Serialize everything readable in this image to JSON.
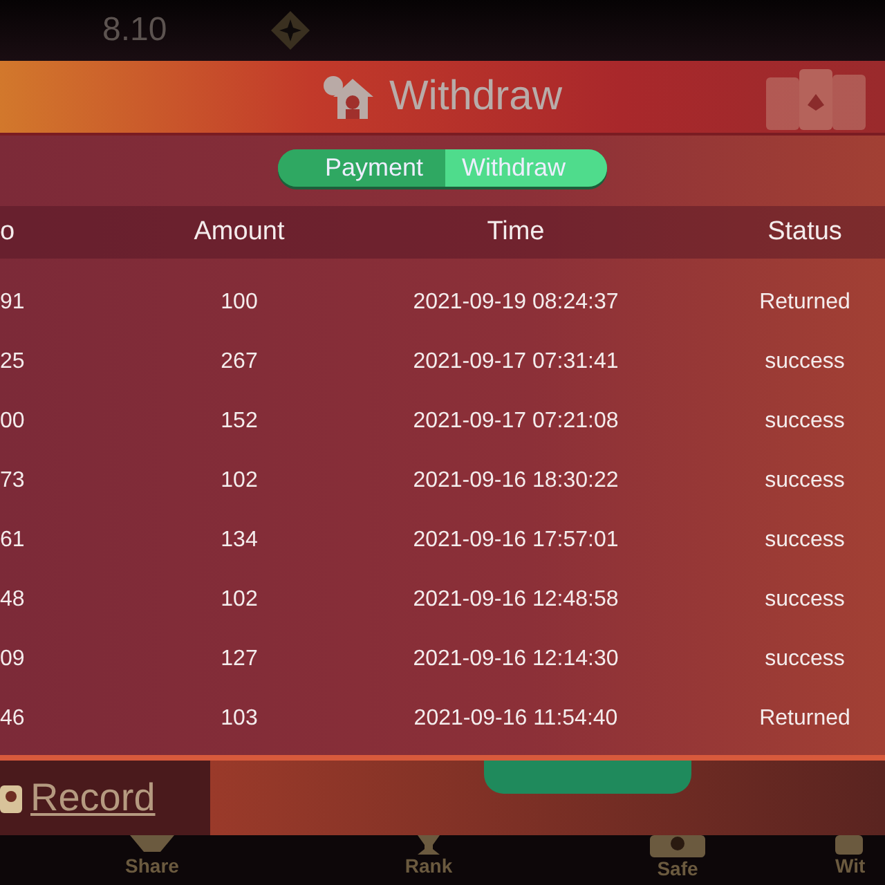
{
  "top_bar": {
    "balance": "8.10"
  },
  "dialog": {
    "title": "Withdraw",
    "tabs": [
      {
        "label": "Payment",
        "selected": false
      },
      {
        "label": "Withdraw",
        "selected": true
      }
    ],
    "table": {
      "columns": [
        "o",
        "Amount",
        "Time",
        "Status"
      ],
      "rows": [
        [
          "91",
          "100",
          "2021-09-19 08:24:37",
          "Returned"
        ],
        [
          "25",
          "267",
          "2021-09-17 07:31:41",
          "success"
        ],
        [
          "00",
          "152",
          "2021-09-17 07:21:08",
          "success"
        ],
        [
          "73",
          "102",
          "2021-09-16 18:30:22",
          "success"
        ],
        [
          "61",
          "134",
          "2021-09-16 17:57:01",
          "success"
        ],
        [
          "48",
          "102",
          "2021-09-16 12:48:58",
          "success"
        ],
        [
          "09",
          "127",
          "2021-09-16 12:14:30",
          "success"
        ],
        [
          "46",
          "103",
          "2021-09-16 11:54:40",
          "Returned"
        ]
      ]
    }
  },
  "record_link": "Record",
  "bottom_nav": [
    {
      "label": "Share",
      "kind": "share"
    },
    {
      "label": "Rank",
      "kind": "rank"
    },
    {
      "label": "Safe",
      "kind": "safe"
    },
    {
      "label": "Wit",
      "kind": "withdraw"
    }
  ]
}
